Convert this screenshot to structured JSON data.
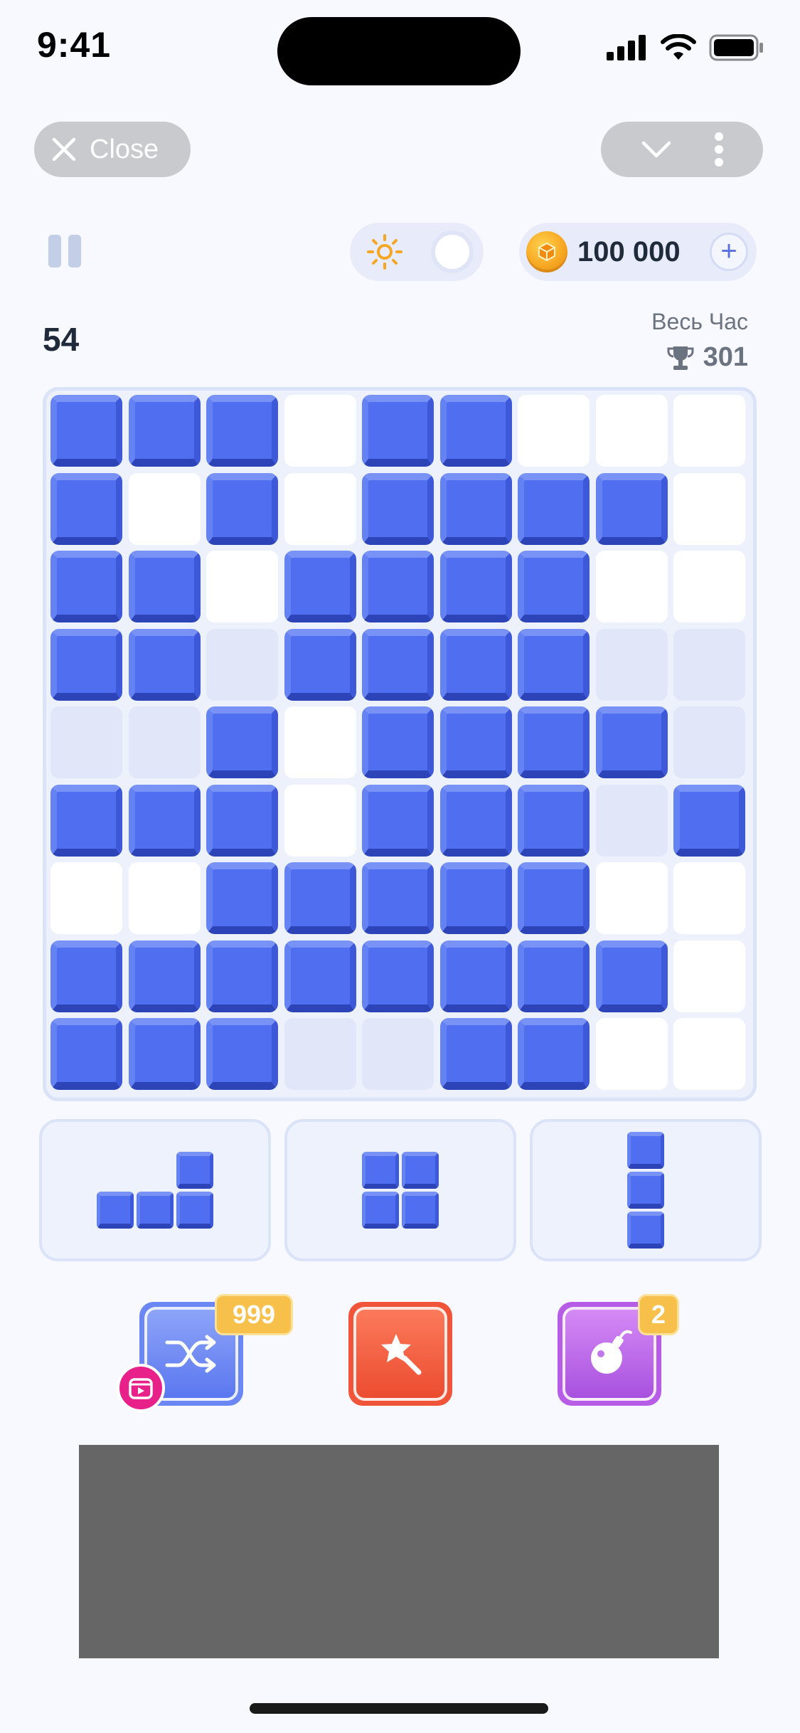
{
  "status_bar": {
    "time": "9:41"
  },
  "top_bar": {
    "close_label": "Close"
  },
  "hud": {
    "coins": "100 000",
    "coin_plus": "+",
    "score": "54",
    "best_label": "Весь Час",
    "best_score": "301"
  },
  "board": {
    "size": 9,
    "legend": {
      "X": "filled block",
      ".": "empty cell",
      "h": "highlighted empty cell"
    },
    "rows": [
      "XXX.XX...",
      "X.X.XXXX.",
      "XX.XXXX..",
      "XXhXXXXhh",
      "hhX.XXXXh",
      "XXX.XXXhX",
      "..XXXXX..",
      "XXXXXXXX.",
      "XXXhhXX.."
    ]
  },
  "pieces": [
    {
      "name": "j-piece",
      "cells": [
        [
          2,
          0
        ],
        [
          0,
          1
        ],
        [
          1,
          1
        ],
        [
          2,
          1
        ]
      ]
    },
    {
      "name": "square-piece",
      "cells": [
        [
          0,
          0
        ],
        [
          1,
          0
        ],
        [
          0,
          1
        ],
        [
          1,
          1
        ]
      ]
    },
    {
      "name": "vertical-3-piece",
      "cells": [
        [
          0,
          0
        ],
        [
          0,
          1
        ],
        [
          0,
          2
        ]
      ]
    }
  ],
  "boosters": {
    "shuffle": {
      "icon": "shuffle-icon",
      "count": "999"
    },
    "magic_wand": {
      "icon": "magic-wand-icon"
    },
    "bomb": {
      "icon": "bomb-icon",
      "count": "2"
    }
  },
  "colors": {
    "block": "#4f6ff0",
    "board_bg": "#edf1fb",
    "coin": "#f7a823",
    "shuffle_booster": "#6b87f4",
    "wand_booster": "#f0553a",
    "bomb_booster": "#b65ce6",
    "badge": "#f7c04a",
    "ad_placeholder": "#666666"
  }
}
